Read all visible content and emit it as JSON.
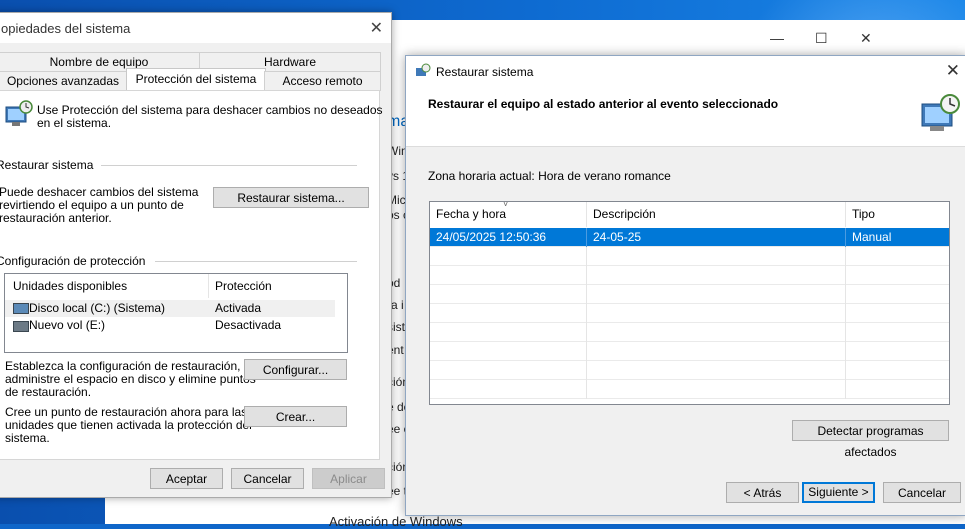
{
  "background_window": {
    "title_partial": "ma",
    "lines": [
      "Win",
      "vs 1",
      "Mic",
      "os c",
      "od",
      "ra i",
      "sist",
      "ent",
      "ción",
      "e de",
      "ee c",
      "ción",
      "ee t",
      "Activación de Windows"
    ]
  },
  "system_properties": {
    "title": "opiedades del sistema",
    "tabs_row1": [
      "Nombre de equipo",
      "Hardware"
    ],
    "tabs_row2": [
      "Opciones avanzadas",
      "Protección del sistema",
      "Acceso remoto"
    ],
    "intro_line1": "Use Protección del sistema para deshacer cambios no deseados",
    "intro_line2": "en el sistema.",
    "restore_group": "Restaurar sistema",
    "restore_text1": "Puede deshacer cambios del sistema",
    "restore_text2": "revirtiendo el equipo a un punto de",
    "restore_text3": "restauración anterior.",
    "restore_button": "Restaurar sistema...",
    "protection_group": "Configuración de protección",
    "list_headers": [
      "Unidades disponibles",
      "Protección"
    ],
    "drives": [
      {
        "name": "Disco local (C:) (Sistema)",
        "status": "Activada"
      },
      {
        "name": "Nuevo vol (E:)",
        "status": "Desactivada"
      }
    ],
    "config_text1": "Establezca la configuración de restauración,",
    "config_text2": "administre el espacio en disco y elimine puntos",
    "config_text3": "de restauración.",
    "config_button": "Configurar...",
    "create_text1": "Cree un punto de restauración ahora para las",
    "create_text2": "unidades que tienen activada la protección del",
    "create_text3": "sistema.",
    "create_button": "Crear...",
    "ok": "Aceptar",
    "cancel": "Cancelar",
    "apply": "Aplicar"
  },
  "restore_dialog": {
    "title": "Restaurar sistema",
    "headline": "Restaurar el equipo al estado anterior al evento seleccionado",
    "timezone": "Zona horaria actual: Hora de verano romance",
    "columns": [
      "Fecha y hora",
      "Descripción",
      "Tipo"
    ],
    "points": [
      {
        "date": "24/05/2025 12:50:36",
        "description": "24-05-25",
        "type": "Manual"
      }
    ],
    "detect_button": "Detectar programas afectados",
    "back_button": "< Atrás",
    "next_button": "Siguiente >",
    "cancel_button": "Cancelar"
  },
  "colors": {
    "accent": "#0078d7",
    "desktop": "#0e6bd1"
  }
}
